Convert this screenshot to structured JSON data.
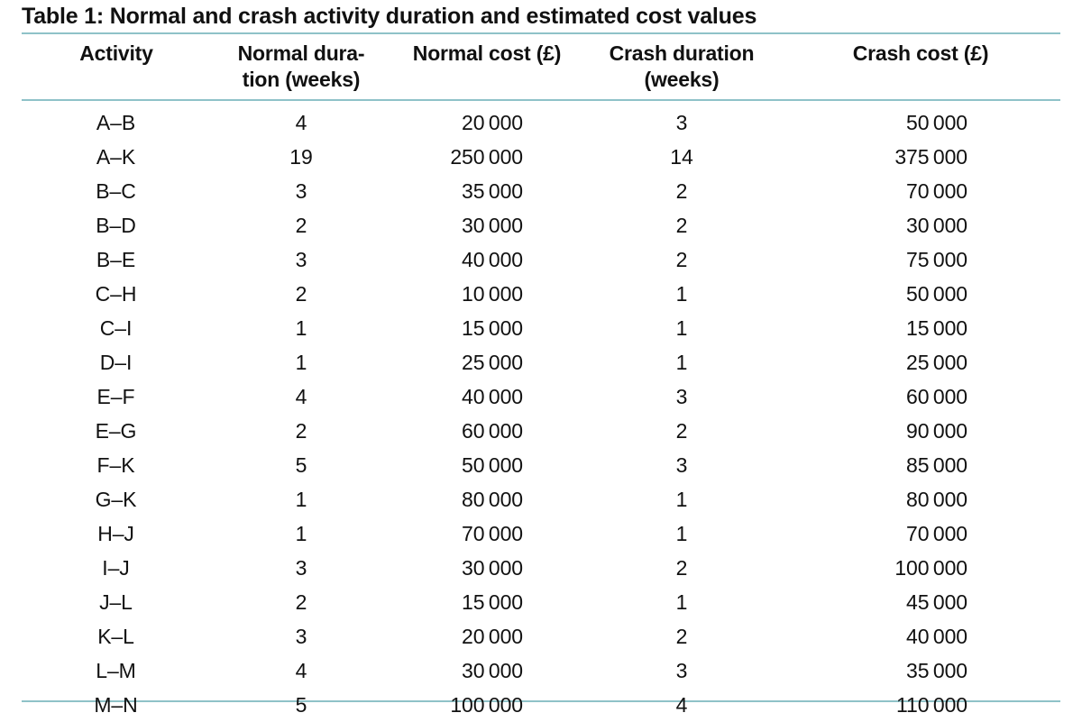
{
  "caption": "Table 1: Normal and crash activity duration and estimated cost values",
  "rule_color": "#8fc2c8",
  "columns": [
    {
      "key": "activity",
      "label": "Activity"
    },
    {
      "key": "normal_duration",
      "label": "Normal dura-\ntion (weeks)",
      "line1": "Normal dura-",
      "line2": "tion (weeks)"
    },
    {
      "key": "normal_cost",
      "label": "Normal cost (£)"
    },
    {
      "key": "crash_duration",
      "label": "Crash duration\n(weeks)",
      "line1": "Crash duration",
      "line2": "(weeks)"
    },
    {
      "key": "crash_cost",
      "label": "Crash cost (£)"
    }
  ],
  "rows": [
    {
      "activity": "A–B",
      "normal_duration": "4",
      "normal_cost": "20 000",
      "crash_duration": "3",
      "crash_cost": "50 000"
    },
    {
      "activity": "A–K",
      "normal_duration": "19",
      "normal_cost": "250 000",
      "crash_duration": "14",
      "crash_cost": "375 000"
    },
    {
      "activity": "B–C",
      "normal_duration": "3",
      "normal_cost": "35 000",
      "crash_duration": "2",
      "crash_cost": "70 000"
    },
    {
      "activity": "B–D",
      "normal_duration": "2",
      "normal_cost": "30 000",
      "crash_duration": "2",
      "crash_cost": "30 000"
    },
    {
      "activity": "B–E",
      "normal_duration": "3",
      "normal_cost": "40 000",
      "crash_duration": "2",
      "crash_cost": "75 000"
    },
    {
      "activity": "C–H",
      "normal_duration": "2",
      "normal_cost": "10 000",
      "crash_duration": "1",
      "crash_cost": "50 000"
    },
    {
      "activity": "C–I",
      "normal_duration": "1",
      "normal_cost": "15 000",
      "crash_duration": "1",
      "crash_cost": "15 000"
    },
    {
      "activity": "D–I",
      "normal_duration": "1",
      "normal_cost": "25 000",
      "crash_duration": "1",
      "crash_cost": "25 000"
    },
    {
      "activity": "E–F",
      "normal_duration": "4",
      "normal_cost": "40 000",
      "crash_duration": "3",
      "crash_cost": "60 000"
    },
    {
      "activity": "E–G",
      "normal_duration": "2",
      "normal_cost": "60 000",
      "crash_duration": "2",
      "crash_cost": "90 000"
    },
    {
      "activity": "F–K",
      "normal_duration": "5",
      "normal_cost": "50 000",
      "crash_duration": "3",
      "crash_cost": "85 000"
    },
    {
      "activity": "G–K",
      "normal_duration": "1",
      "normal_cost": "80 000",
      "crash_duration": "1",
      "crash_cost": "80 000"
    },
    {
      "activity": "H–J",
      "normal_duration": "1",
      "normal_cost": "70 000",
      "crash_duration": "1",
      "crash_cost": "70 000"
    },
    {
      "activity": "I–J",
      "normal_duration": "3",
      "normal_cost": "30 000",
      "crash_duration": "2",
      "crash_cost": "100 000"
    },
    {
      "activity": "J–L",
      "normal_duration": "2",
      "normal_cost": "15 000",
      "crash_duration": "1",
      "crash_cost": "45 000"
    },
    {
      "activity": "K–L",
      "normal_duration": "3",
      "normal_cost": "20 000",
      "crash_duration": "2",
      "crash_cost": "40 000"
    },
    {
      "activity": "L–M",
      "normal_duration": "4",
      "normal_cost": "30 000",
      "crash_duration": "3",
      "crash_cost": "35 000"
    },
    {
      "activity": "M–N",
      "normal_duration": "5",
      "normal_cost": "100 000",
      "crash_duration": "4",
      "crash_cost": "110 000"
    }
  ]
}
